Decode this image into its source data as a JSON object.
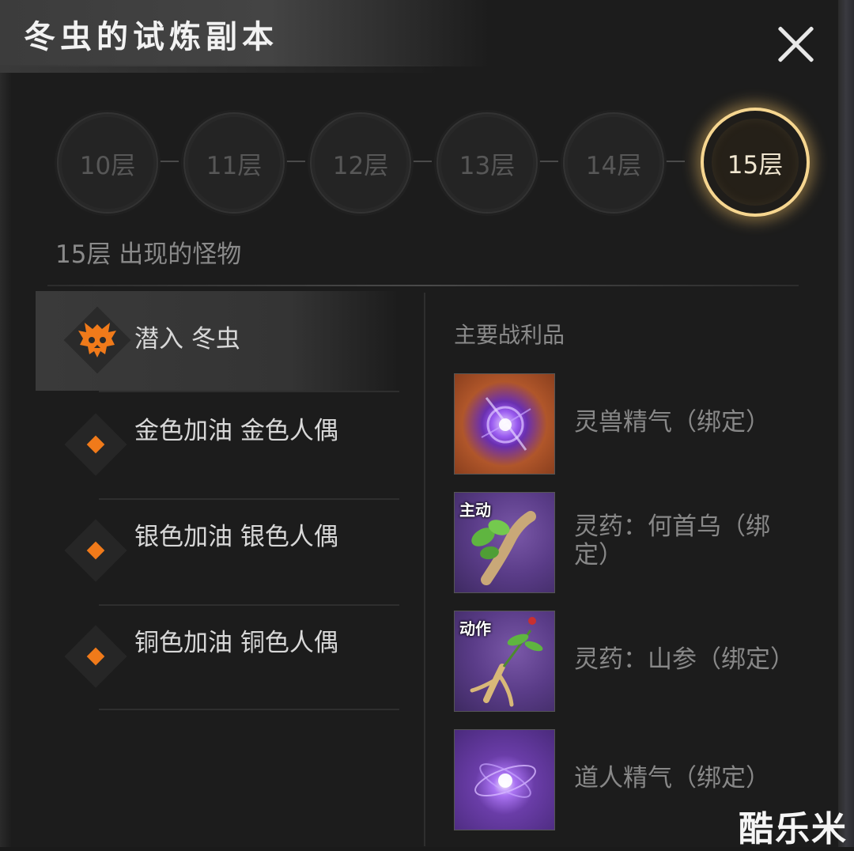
{
  "window": {
    "title": "冬虫的试炼副本"
  },
  "floors": [
    {
      "label": "10层",
      "active": false
    },
    {
      "label": "11层",
      "active": false
    },
    {
      "label": "12层",
      "active": false
    },
    {
      "label": "13层",
      "active": false
    },
    {
      "label": "14层",
      "active": false
    },
    {
      "label": "15层",
      "active": true
    }
  ],
  "monsters_header": "15层 出现的怪物",
  "monsters": [
    {
      "name": "潜入 冬虫",
      "type": "boss",
      "icon": "demon-skull-icon",
      "selected": true
    },
    {
      "name": "金色加油 金色人偶",
      "type": "normal",
      "icon": "orange-diamond-icon",
      "selected": false
    },
    {
      "name": "银色加油 银色人偶",
      "type": "normal",
      "icon": "orange-diamond-icon",
      "selected": false
    },
    {
      "name": "铜色加油 铜色人偶",
      "type": "normal",
      "icon": "orange-diamond-icon",
      "selected": false
    }
  ],
  "loot_header": "主要战利品",
  "loot": [
    {
      "name": "灵兽精气（绑定）",
      "icon": "spirit-beast-essence-icon",
      "tag": ""
    },
    {
      "name": "灵药：何首乌（绑定）",
      "icon": "heshouwu-herb-icon",
      "tag": "主动"
    },
    {
      "name": "灵药：山参（绑定）",
      "icon": "ginseng-herb-icon",
      "tag": "动作"
    },
    {
      "name": "道人精气（绑定）",
      "icon": "taoist-essence-icon",
      "tag": ""
    }
  ],
  "watermark": "酷乐米",
  "colors": {
    "accent": "#f07a1a",
    "active_ring": "#f6d690",
    "panel": "#1c1c1c",
    "loot_purple": "#6a3d9a",
    "loot_orange": "#c4662a"
  }
}
